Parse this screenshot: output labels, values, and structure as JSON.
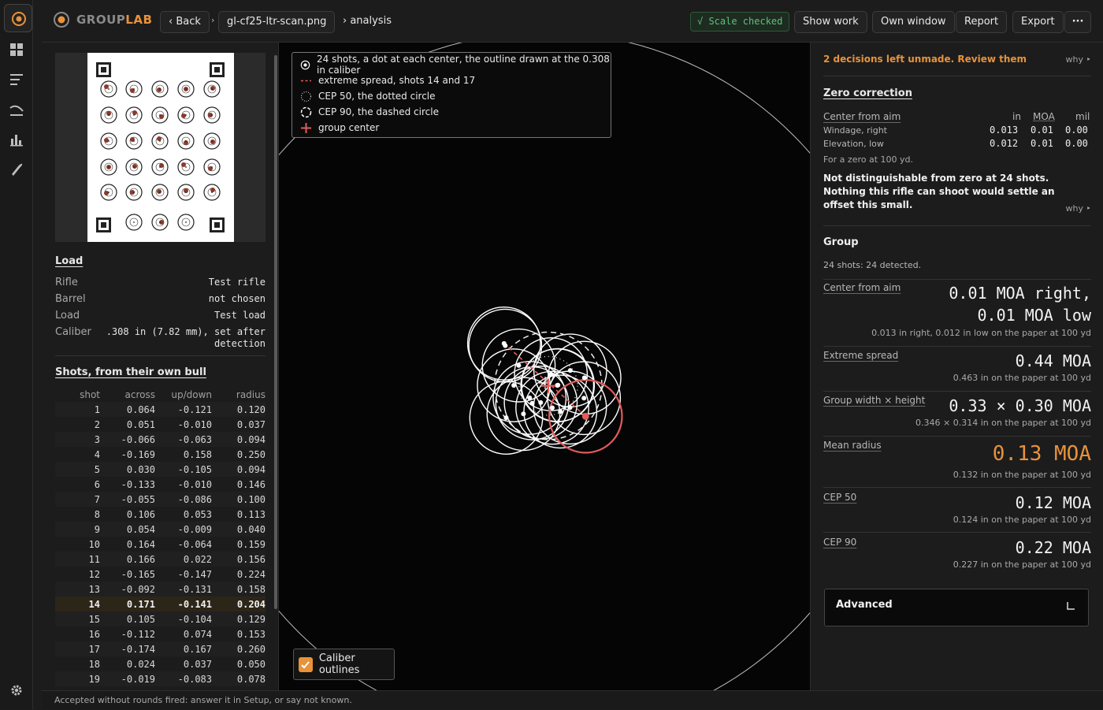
{
  "app": {
    "brand_part1": "GROUP",
    "brand_part2": "LAB"
  },
  "toolbar": {
    "back_label": "‹ Back",
    "crumb_sep": "›",
    "file_label": "gl-cf25-ltr-scan.png",
    "crumb_analysis": "› analysis",
    "scale_badge": "√ Scale checked",
    "show_work": "Show work",
    "own_window": "Own window",
    "report": "Report",
    "export": "Export",
    "more": "···"
  },
  "rail": {
    "icons": [
      "target-logo-icon",
      "dashboard-icon",
      "list-icon",
      "curve-icon",
      "bar-chart-icon",
      "bullet-icon",
      "settings-icon"
    ]
  },
  "load": {
    "title": "Load",
    "rows": [
      {
        "label": "Rifle",
        "value": "Test rifle"
      },
      {
        "label": "Barrel",
        "value": "not chosen"
      },
      {
        "label": "Load",
        "value": "Test load"
      },
      {
        "label": "Caliber",
        "value_line1": ".308 in (7.82 mm), set after",
        "value_line2": "detection"
      }
    ]
  },
  "shots_table": {
    "title": "Shots, from their own bull",
    "headers": [
      "shot",
      "across",
      "up/down",
      "radius"
    ],
    "highlight_shot": "14",
    "rows": [
      [
        "1",
        "0.064",
        "-0.121",
        "0.120"
      ],
      [
        "2",
        "0.051",
        "-0.010",
        "0.037"
      ],
      [
        "3",
        "-0.066",
        "-0.063",
        "0.094"
      ],
      [
        "4",
        "-0.169",
        "0.158",
        "0.250"
      ],
      [
        "5",
        "0.030",
        "-0.105",
        "0.094"
      ],
      [
        "6",
        "-0.133",
        "-0.010",
        "0.146"
      ],
      [
        "7",
        "-0.055",
        "-0.086",
        "0.100"
      ],
      [
        "8",
        "0.106",
        "0.053",
        "0.113"
      ],
      [
        "9",
        "0.054",
        "-0.009",
        "0.040"
      ],
      [
        "10",
        "0.164",
        "-0.064",
        "0.159"
      ],
      [
        "11",
        "0.166",
        "0.022",
        "0.156"
      ],
      [
        "12",
        "-0.165",
        "-0.147",
        "0.224"
      ],
      [
        "13",
        "-0.092",
        "-0.131",
        "0.158"
      ],
      [
        "14",
        "0.171",
        "-0.141",
        "0.204"
      ],
      [
        "15",
        "0.105",
        "-0.104",
        "0.129"
      ],
      [
        "16",
        "-0.112",
        "0.074",
        "0.153"
      ],
      [
        "17",
        "-0.174",
        "0.167",
        "0.260"
      ],
      [
        "18",
        "0.024",
        "0.037",
        "0.050"
      ],
      [
        "19",
        "-0.019",
        "-0.083",
        "0.078"
      ]
    ]
  },
  "legend": {
    "items": [
      {
        "icon": "shot-dot-icon",
        "text": "24 shots, a dot at each center, the outline drawn at the 0.308 in caliber"
      },
      {
        "icon": "dash-line-icon",
        "text": "extreme spread, shots 14 and 17"
      },
      {
        "icon": "dotted-circle-icon",
        "text": "CEP 50, the dotted circle"
      },
      {
        "icon": "dashed-circle-icon",
        "text": "CEP 90, the dashed circle"
      },
      {
        "icon": "cross-icon",
        "text": "group center"
      }
    ]
  },
  "plot": {
    "caliber_outlines_label": "Caliber outlines",
    "caliber_outlines_checked": true,
    "caliber_in": 0.308,
    "colors": {
      "outline": "#ffffff",
      "highlight": "#e25c5c",
      "accent": "#e8923a"
    },
    "group_center": {
      "across": 0.013,
      "updown": -0.012
    },
    "cep50_in": 0.124,
    "cep90_in": 0.227,
    "spread_pair": [
      "14",
      "17"
    ]
  },
  "right": {
    "decisions": "2 decisions left unmade.  Review them",
    "why": "why ‣",
    "zero": {
      "title": "Zero correction",
      "center_from_aim": "Center from aim",
      "cols": [
        "in",
        "MOA",
        "mil"
      ],
      "rows": [
        {
          "label": "Windage, right",
          "in": "0.013",
          "moa": "0.01",
          "mil": "0.00"
        },
        {
          "label": "Elevation, low",
          "in": "0.012",
          "moa": "0.01",
          "mil": "0.00"
        }
      ],
      "note": "For a zero at 100 yd.",
      "verdict_line1": "Not distinguishable from zero at 24 shots.",
      "verdict_line2": "Nothing this rifle can shoot would settle an",
      "verdict_line3": "offset this small."
    },
    "group": {
      "title": "Group",
      "detected": "24 shots: 24 detected.",
      "metrics": [
        {
          "label": "Center from aim",
          "value_line1": "0.01 MOA right,",
          "value_line2": "0.01 MOA low",
          "sub": "0.013 in right, 0.012 in low on the paper at 100 yd"
        },
        {
          "label": "Extreme spread",
          "value": "0.44 MOA",
          "sub": "0.463 in on the paper at 100 yd"
        },
        {
          "label": "Group width × height",
          "value": "0.33 × 0.30 MOA",
          "sub": "0.346 × 0.314 in on the paper at 100 yd"
        },
        {
          "label": "Mean radius",
          "value": "0.13 MOA",
          "sub": "0.132 in on the paper at 100 yd"
        },
        {
          "label": "CEP 50",
          "value": "0.12 MOA",
          "sub": "0.124 in on the paper at 100 yd"
        },
        {
          "label": "CEP 90",
          "value": "0.22 MOA",
          "sub": "0.227 in on the paper at 100 yd"
        }
      ]
    },
    "advanced": "Advanced"
  },
  "status": "Accepted without rounds fired: answer it in Setup, or say not known."
}
